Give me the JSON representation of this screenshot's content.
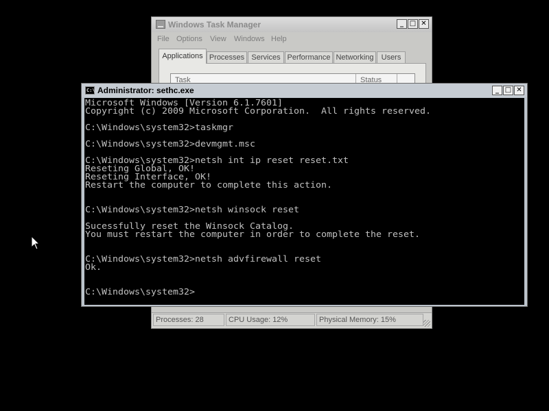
{
  "task_manager": {
    "title": "Windows Task Manager",
    "menu": [
      "File",
      "Options",
      "View",
      "Windows",
      "Help"
    ],
    "tabs": [
      "Applications",
      "Processes",
      "Services",
      "Performance",
      "Networking",
      "Users"
    ],
    "active_tab": "Applications",
    "columns": [
      "Task",
      "Status"
    ],
    "status_bar": {
      "processes": "Processes: 28",
      "cpu": "CPU Usage: 12%",
      "memory": "Physical Memory: 15%"
    }
  },
  "cmd": {
    "title": "Administrator: sethc.exe",
    "icon_text": "C:\\.",
    "lines": [
      "Microsoft Windows [Version 6.1.7601]",
      "Copyright (c) 2009 Microsoft Corporation.  All rights reserved.",
      "",
      "C:\\Windows\\system32>taskmgr",
      "",
      "C:\\Windows\\system32>devmgmt.msc",
      "",
      "C:\\Windows\\system32>netsh int ip reset reset.txt",
      "Reseting Global, OK!",
      "Reseting Interface, OK!",
      "Restart the computer to complete this action.",
      "",
      "",
      "C:\\Windows\\system32>netsh winsock reset",
      "",
      "Sucessfully reset the Winsock Catalog.",
      "You must restart the computer in order to complete the reset.",
      "",
      "",
      "C:\\Windows\\system32>netsh advfirewall reset",
      "Ok.",
      "",
      "",
      "C:\\Windows\\system32>"
    ]
  },
  "caption_buttons": {
    "minimize": "_",
    "maximize": "□",
    "close": "✕"
  },
  "icons": {
    "taskmgr": "taskmgr-app-icon",
    "cmd": "cmd-app-icon",
    "pointer": "mouse-pointer-icon"
  }
}
